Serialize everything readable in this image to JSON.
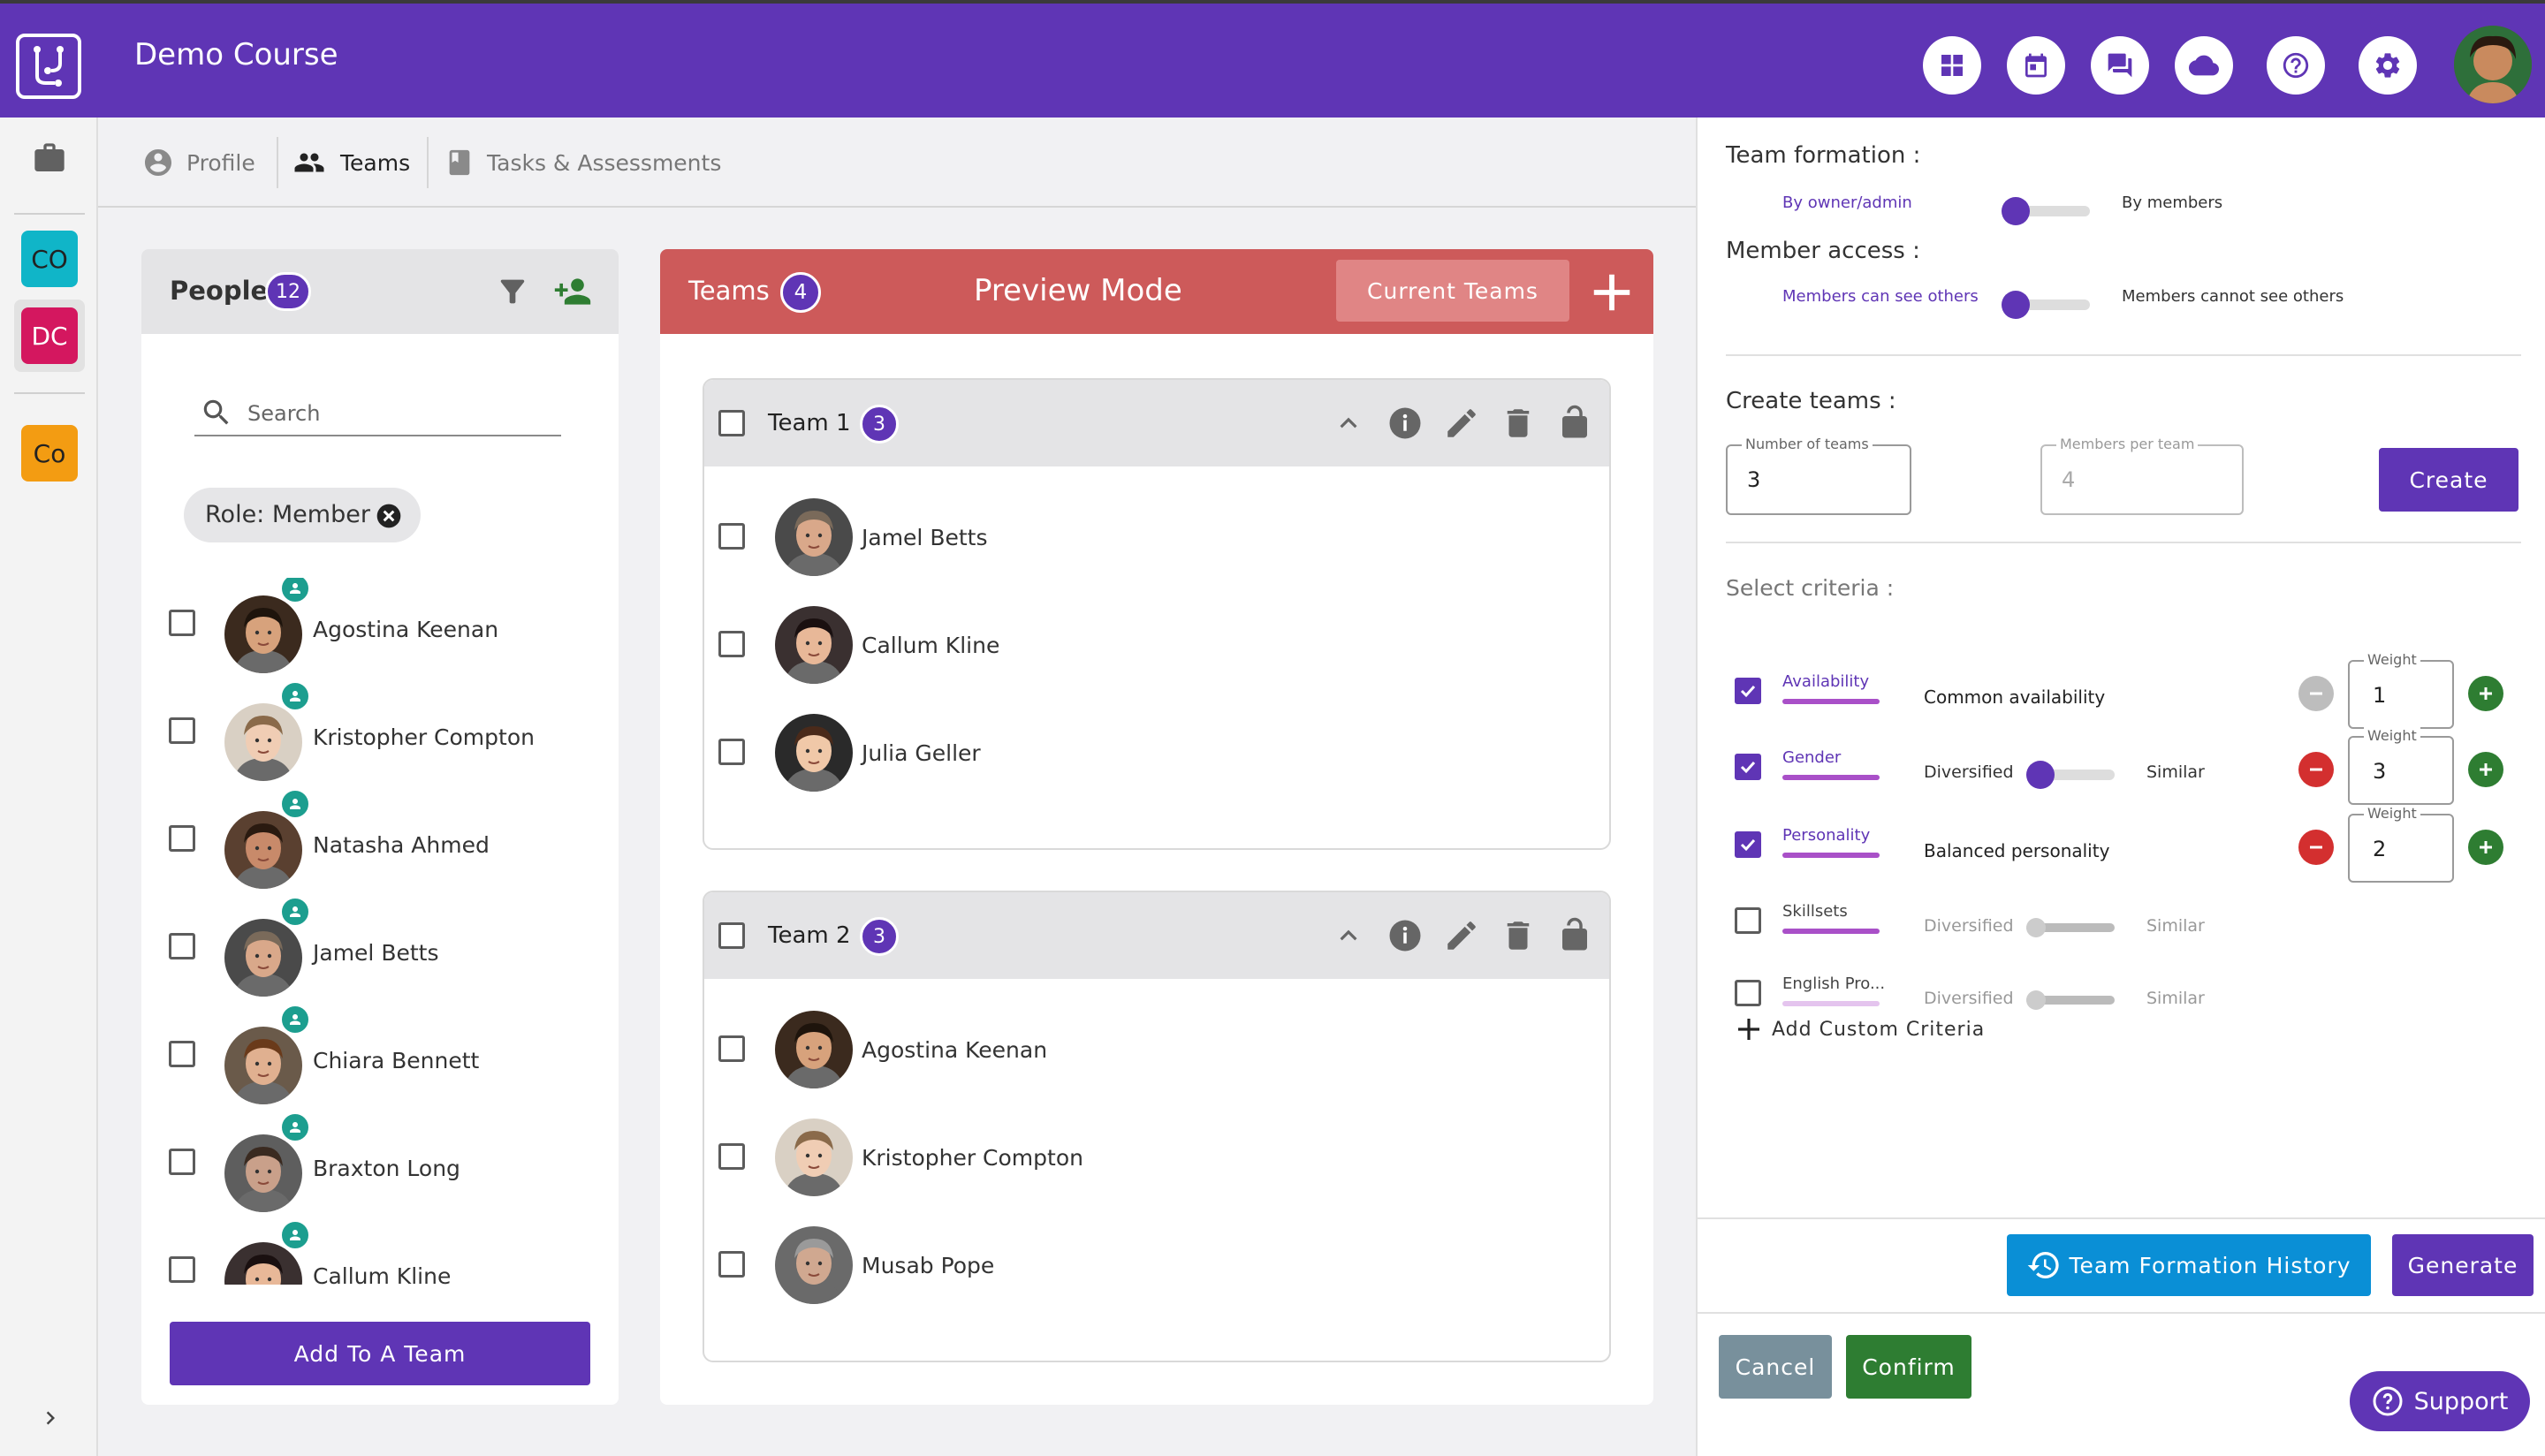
{
  "app": {
    "course_title": "Demo Course"
  },
  "topbar_icons": [
    "dashboard-icon",
    "calendar-icon",
    "chat-icon",
    "cloud-icon",
    "help-icon",
    "settings-icon"
  ],
  "rail": {
    "chips": [
      {
        "label": "CO",
        "bg": "#10b5c8",
        "fg": "#222222"
      },
      {
        "label": "DC",
        "bg": "#d4175f",
        "fg": "#ffffff"
      },
      {
        "label": "Co",
        "bg": "#f39c12",
        "fg": "#222222"
      }
    ]
  },
  "tabs": {
    "profile": "Profile",
    "teams": "Teams",
    "tasks": "Tasks & Assessments"
  },
  "people": {
    "title": "People",
    "count": "12",
    "search_placeholder": "Search",
    "filter_chip": "Role: Member",
    "members": [
      "Agostina Keenan",
      "Kristopher Compton",
      "Natasha Ahmed",
      "Jamel Betts",
      "Chiara Bennett",
      "Braxton Long",
      "Callum Kline"
    ],
    "add_button": "Add To A Team"
  },
  "teams_panel": {
    "title": "Teams",
    "count": "4",
    "mode": "Preview Mode",
    "current_button": "Current Teams",
    "teams": [
      {
        "name": "Team 1",
        "count": "3",
        "members": [
          "Jamel Betts",
          "Callum Kline",
          "Julia Geller"
        ]
      },
      {
        "name": "Team 2",
        "count": "3",
        "members": [
          "Agostina Keenan",
          "Kristopher Compton",
          "Musab Pope"
        ]
      }
    ]
  },
  "settings": {
    "formation_label": "Team formation :",
    "formation_left": "By owner/admin",
    "formation_right": "By members",
    "access_label": "Member access :",
    "access_left": "Members can see others",
    "access_right": "Members cannot see others",
    "create_label": "Create teams :",
    "num_teams_legend": "Number of teams",
    "num_teams_value": "3",
    "per_team_legend": "Members per team",
    "per_team_value": "4",
    "create_button": "Create",
    "criteria_label": "Select criteria :",
    "criteria": [
      {
        "name": "Availability",
        "checked": true,
        "desc": "Common availability",
        "left": "",
        "right": "",
        "weight": "1",
        "weight_legend": "Weight"
      },
      {
        "name": "Gender",
        "checked": true,
        "desc": "",
        "left": "Diversified",
        "right": "Similar",
        "weight": "3",
        "weight_legend": "Weight"
      },
      {
        "name": "Personality",
        "checked": true,
        "desc": "Balanced personality",
        "left": "",
        "right": "",
        "weight": "2",
        "weight_legend": "Weight"
      },
      {
        "name": "Skillsets",
        "checked": false,
        "desc": "",
        "left": "Diversified",
        "right": "Similar"
      },
      {
        "name": "English Pro...",
        "checked": false,
        "desc": "",
        "left": "Diversified",
        "right": "Similar"
      }
    ],
    "add_custom": "Add Custom Criteria",
    "history_button": "Team Formation History",
    "generate_button": "Generate",
    "cancel_button": "Cancel",
    "confirm_button": "Confirm"
  },
  "support": {
    "label": "Support"
  },
  "colors": {
    "primary": "#5f35b5",
    "teams_header": "#cd5a5a",
    "history": "#0a8fd6",
    "confirm": "#2e7d32",
    "cancel": "#78909c"
  }
}
